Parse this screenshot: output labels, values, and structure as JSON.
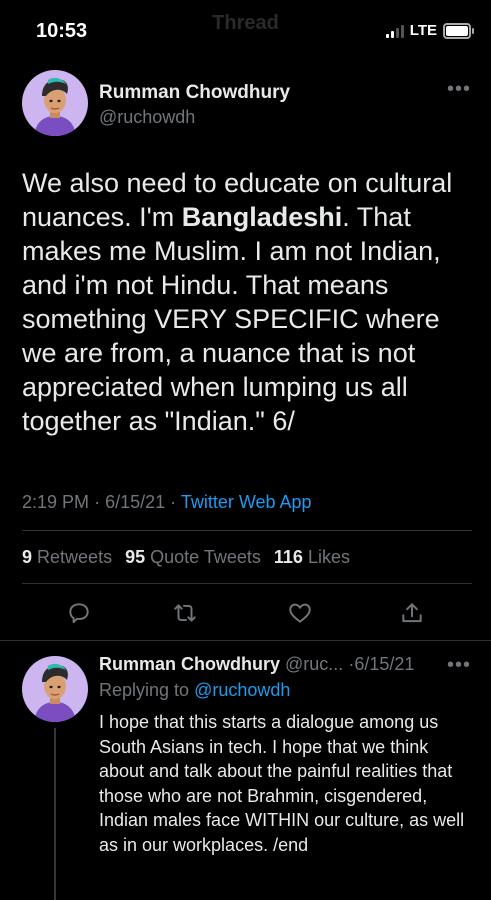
{
  "status_bar": {
    "time": "10:53",
    "ghost_title": "Thread",
    "network": "LTE"
  },
  "main_tweet": {
    "author": {
      "display_name": "Rumman Chowdhury",
      "handle": "@ruchowdh"
    },
    "more_icon": "more-horizontal-icon",
    "text_parts": {
      "before": "We also need to educate on cultural nuances. I'm ",
      "bold": "Bangladeshi",
      "after": ". That makes me Muslim. I am not Indian, and i'm not Hindu. That means something VERY SPECIFIC where we are from, a nuance that is not appreciated when lumping us all together as \"Indian.\" 6/"
    },
    "time": "2:19 PM",
    "separator": "·",
    "date": "6/15/21",
    "source": "Twitter Web App",
    "stats": {
      "retweets_count": "9",
      "retweets_label": "Retweets",
      "quotes_count": "95",
      "quotes_label": "Quote Tweets",
      "likes_count": "116",
      "likes_label": "Likes"
    },
    "actions": [
      "reply-icon",
      "retweet-icon",
      "like-icon",
      "share-icon"
    ]
  },
  "reply_tweet": {
    "display_name": "Rumman Chowdhury",
    "handle_truncated": "@ruc...",
    "separator": "·",
    "date": "6/15/21",
    "replying_label": "Replying to",
    "replying_to": "@ruchowdh",
    "text": "I hope that this starts a dialogue among us South Asians in tech. I hope that we think about and talk about the painful realities that those who are not Brahmin, cisgendered, Indian males face WITHIN our culture,  as well as in our workplaces. /end"
  },
  "colors": {
    "background": "#000000",
    "text": "#e7e9ea",
    "muted": "#71767b",
    "link": "#1d9bf0",
    "divider": "#2f3336"
  }
}
